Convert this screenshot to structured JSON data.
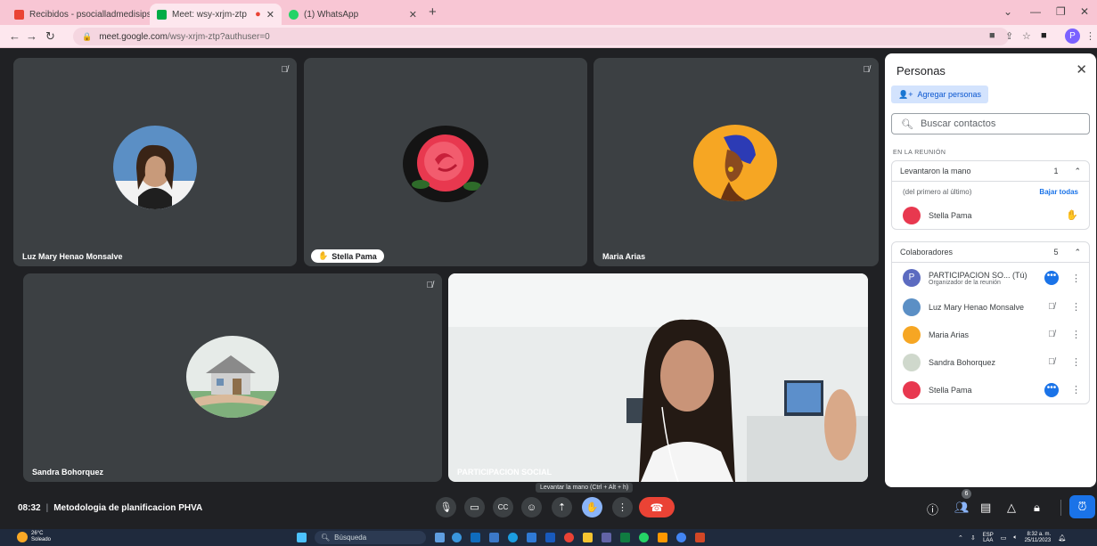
{
  "browser": {
    "tabs": [
      {
        "label": "Recibidos - psocialladmedisips..."
      },
      {
        "label": "Meet: wsy-xrjm-ztp"
      },
      {
        "label": "(1) WhatsApp"
      }
    ],
    "url_host": "meet.google.com",
    "url_path": "/wsy-xrjm-ztp?authuser=0",
    "profile_initial": "P"
  },
  "tiles": [
    {
      "name": "Luz Mary Henao Monsalve"
    },
    {
      "name": "Stella Pama"
    },
    {
      "name": "Maria Arias"
    },
    {
      "name": "Sandra Bohorquez"
    },
    {
      "name": "PARTICIPACION SOCIAL"
    }
  ],
  "people_panel": {
    "title": "Personas",
    "add_label": "Agregar personas",
    "search_placeholder": "Buscar contactos",
    "section_label": "EN LA REUNIÓN",
    "raised": {
      "label": "Levantaron la mano",
      "count": "1",
      "order_note": "(del primero al último)",
      "lower_all": "Bajar todas",
      "person": "Stella Pama"
    },
    "collab": {
      "label": "Colaboradores",
      "count": "5",
      "people": [
        {
          "name": "PARTICIPACION SO...  (Tú)",
          "sub": "Organizador de la reunión",
          "initial": "P"
        },
        {
          "name": "Luz Mary Henao Monsalve"
        },
        {
          "name": "Maria Arias"
        },
        {
          "name": "Sandra Bohorquez"
        },
        {
          "name": "Stella Pama"
        }
      ]
    }
  },
  "meeting": {
    "time": "08:32",
    "title": "Metodologia de planificacion PHVA",
    "tooltip": "Levantar la mano (Ctrl + Alt + h)",
    "people_count": "6"
  },
  "taskbar": {
    "temp": "26°C",
    "weather": "Soleado",
    "search": "Búsqueda",
    "lang1": "ESP",
    "lang2": "LAA",
    "time": "8:32 a. m.",
    "date": "25/11/2023"
  },
  "colors": {
    "meet_bg": "#202124",
    "tile_bg": "#3c4043",
    "accent": "#1a73e8",
    "hangup": "#ea4335",
    "chrome_tab": "#f8c6d4"
  }
}
